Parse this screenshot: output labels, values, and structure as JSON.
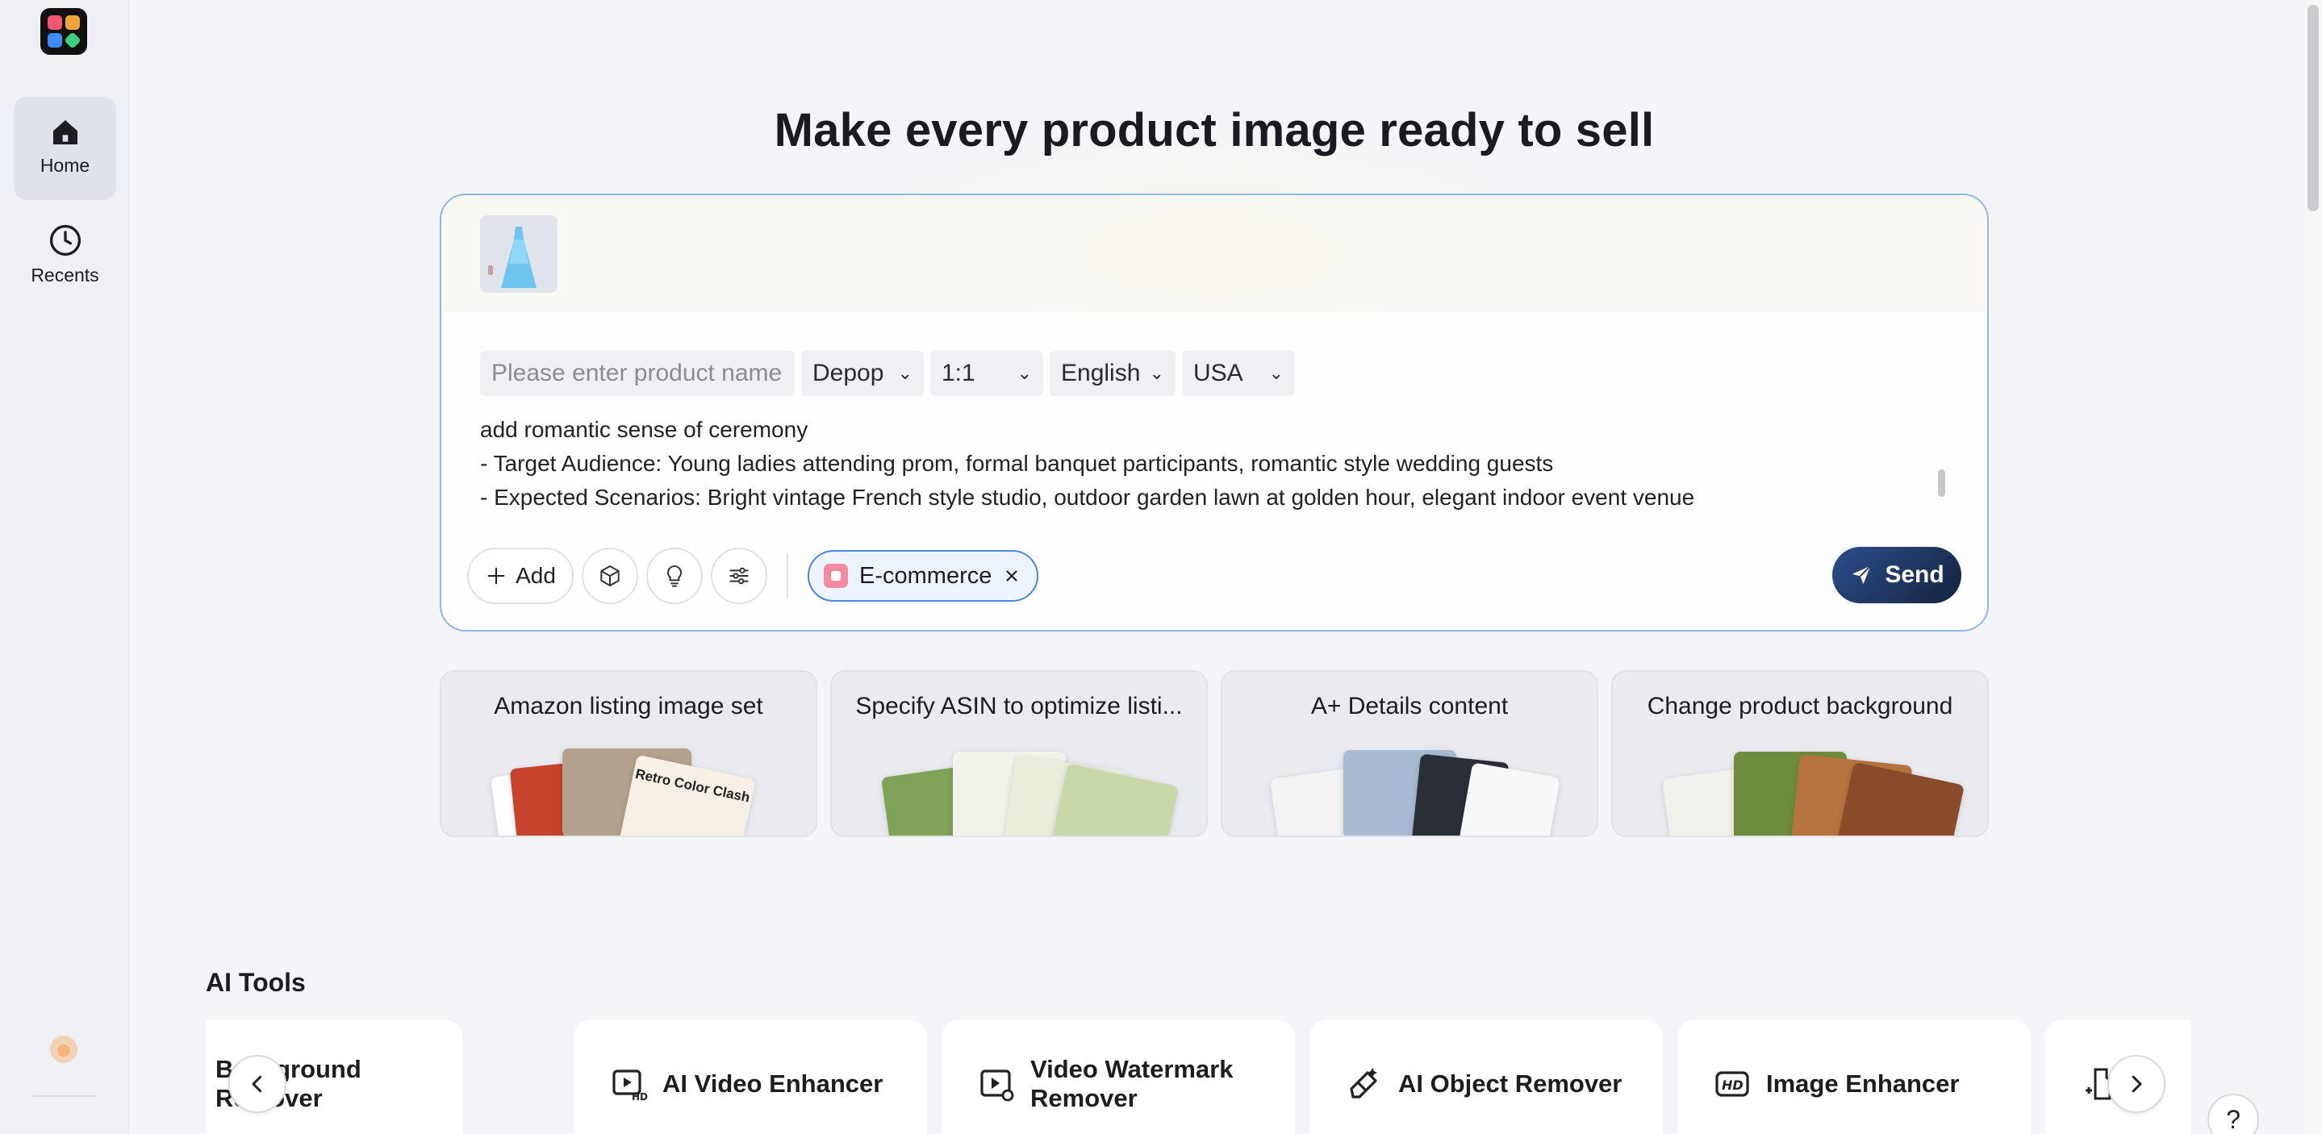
{
  "sidebar": {
    "items": [
      {
        "label": "Home",
        "icon": "home-icon",
        "active": true
      },
      {
        "label": "Recents",
        "icon": "clock-icon",
        "active": false
      }
    ]
  },
  "hero": {
    "title": "Make every product image ready to sell"
  },
  "composer": {
    "product_name_placeholder": "Please enter product name",
    "platform": "Depop",
    "ratio": "1:1",
    "language": "English",
    "region": "USA",
    "prompt_lines": [
      "add romantic sense of ceremony",
      "- Target Audience: Young ladies attending prom, formal banquet participants, romantic style wedding guests",
      "- Expected Scenarios: Bright vintage French style studio, outdoor garden lawn at golden hour, elegant indoor event venue"
    ],
    "add_label": "Add",
    "chip_label": "E-commerce",
    "send_label": "Send"
  },
  "cards": [
    {
      "title": "Amazon listing image set",
      "art_text": "Retro Color Clash"
    },
    {
      "title": "Specify ASIN to optimize listi..."
    },
    {
      "title": "A+ Details content"
    },
    {
      "title": "Change product background"
    }
  ],
  "ai_tools": {
    "title": "AI Tools",
    "items": [
      {
        "label": "Background Remover"
      },
      {
        "label": "AI Video Enhancer"
      },
      {
        "label": "Video Watermark Remover"
      },
      {
        "label": "AI Object Remover"
      },
      {
        "label": "Image Enhancer"
      }
    ]
  },
  "help_label": "?",
  "colors": {
    "accent": "#4c86e0",
    "send_bg": "#1c2f55",
    "page_bg": "#f4f5f9"
  }
}
